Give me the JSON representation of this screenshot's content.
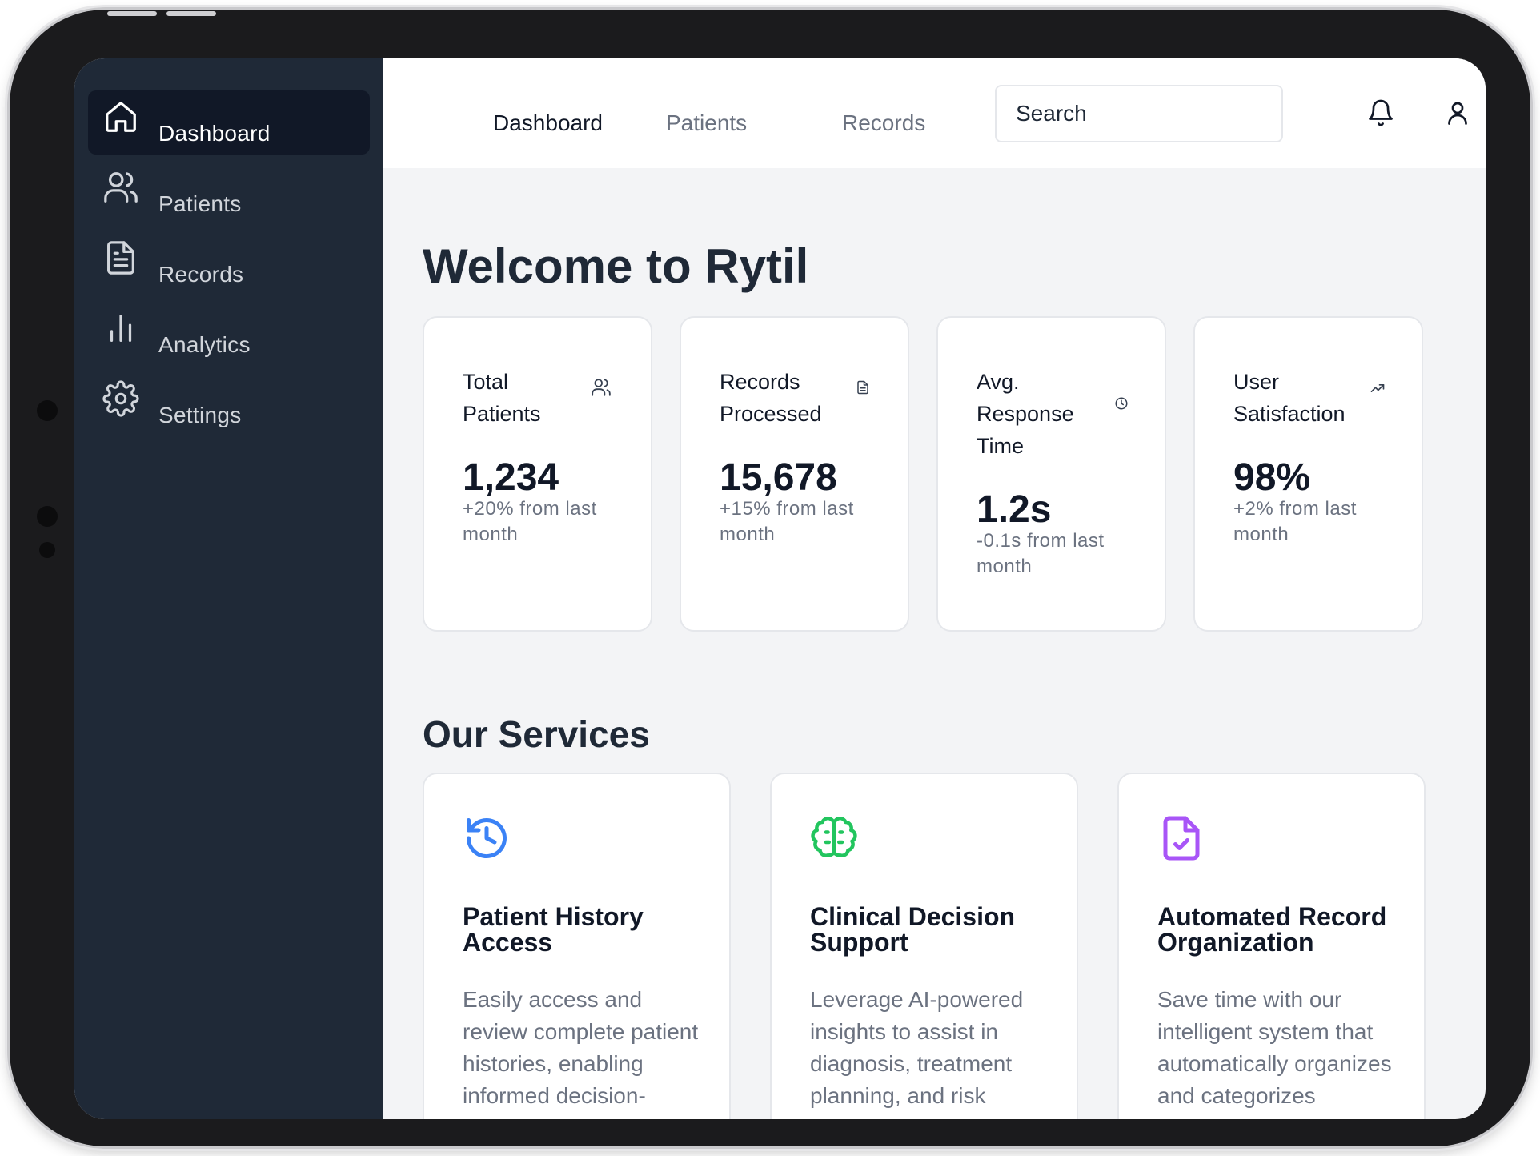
{
  "sidebar": {
    "items": [
      {
        "label": "Dashboard",
        "icon": "home-icon",
        "active": true
      },
      {
        "label": "Patients",
        "icon": "users-icon",
        "active": false
      },
      {
        "label": "Records",
        "icon": "file-text-icon",
        "active": false
      },
      {
        "label": "Analytics",
        "icon": "bar-chart-icon",
        "active": false
      },
      {
        "label": "Settings",
        "icon": "gear-icon",
        "active": false
      }
    ]
  },
  "header": {
    "tabs": [
      {
        "label": "Dashboard",
        "active": true
      },
      {
        "label": "Patients",
        "active": false
      },
      {
        "label": "Records",
        "active": false
      }
    ],
    "search": {
      "placeholder": "Search"
    },
    "icons": [
      "bell-icon",
      "user-icon"
    ]
  },
  "main": {
    "title": "Welcome to Rytil",
    "stats": [
      {
        "title": "Total Patients",
        "value": "1,234",
        "change": "+20% from last month",
        "icon": "users-icon"
      },
      {
        "title": "Records Processed",
        "value": "15,678",
        "change": "+15% from last month",
        "icon": "file-icon"
      },
      {
        "title": "Avg. Response Time",
        "value": "1.2s",
        "change": "-0.1s from last month",
        "icon": "clock-icon"
      },
      {
        "title": "User Satisfaction",
        "value": "98%",
        "change": "+2% from last month",
        "icon": "trending-up-icon"
      }
    ],
    "services_title": "Our Services",
    "services": [
      {
        "title": "Patient History Access",
        "description": "Easily access and review complete patient histories, enabling informed decision-making and",
        "icon": "history-icon",
        "color": "#3b82f6"
      },
      {
        "title": "Clinical Decision Support",
        "description": "Leverage AI-powered insights to assist in diagnosis, treatment planning, and risk assessment",
        "icon": "brain-icon",
        "color": "#22c55e"
      },
      {
        "title": "Automated Record Organization",
        "description": "Save time with our intelligent system that automatically organizes and categorizes medical",
        "icon": "file-check-icon",
        "color": "#a855f7"
      }
    ]
  },
  "colors": {
    "sidebar_bg": "#1f2937",
    "sidebar_active_bg": "#111827",
    "page_bg": "#f3f4f6",
    "text_primary": "#111827",
    "text_muted": "#6b7280"
  }
}
